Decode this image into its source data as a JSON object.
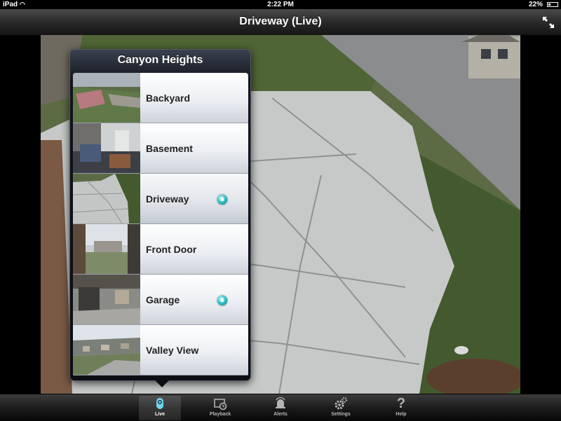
{
  "status_bar": {
    "carrier": "iPad",
    "time": "2:22 PM",
    "battery": "22%"
  },
  "header": {
    "title": "Driveway (Live)"
  },
  "popover": {
    "title": "Canyon Heights",
    "cameras": [
      {
        "label": "Backyard",
        "alert": false
      },
      {
        "label": "Basement",
        "alert": false
      },
      {
        "label": "Driveway",
        "alert": true
      },
      {
        "label": "Front Door",
        "alert": false
      },
      {
        "label": "Garage",
        "alert": true
      },
      {
        "label": "Valley View",
        "alert": false
      }
    ]
  },
  "tabbar": {
    "tabs": [
      {
        "label": "Live",
        "icon": "camera-icon",
        "active": true
      },
      {
        "label": "Playback",
        "icon": "playback-icon",
        "active": false
      },
      {
        "label": "Alerts",
        "icon": "alerts-icon",
        "active": false
      },
      {
        "label": "Settings",
        "icon": "gear-icon",
        "active": false
      },
      {
        "label": "Help",
        "icon": "help-icon",
        "active": false
      }
    ]
  },
  "colors": {
    "alert_indicator": "#35c6c8",
    "bar_dark": "#1c1c1c"
  }
}
